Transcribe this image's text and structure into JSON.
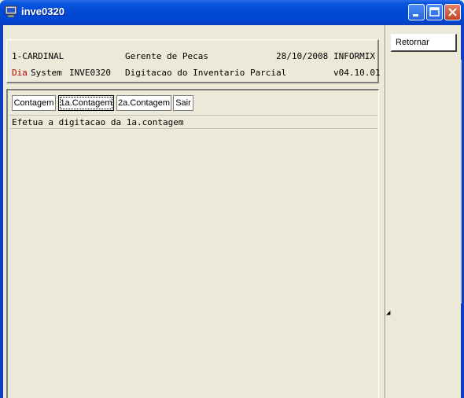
{
  "window": {
    "title": "inve0320"
  },
  "header": {
    "company": "1-CARDINAL",
    "module_title": "Gerente de Pecas",
    "date": "28/10/2008",
    "database": "INFORMIX",
    "brand_dia": "Dia",
    "brand_system": "System",
    "program": "INVE0320",
    "program_title": "Digitacao do Inventario Parcial",
    "version": "v04.10.01"
  },
  "menu": {
    "items": [
      {
        "label": "Contagem"
      },
      {
        "label": "1a.Contagem"
      },
      {
        "label": "2a.Contagem"
      },
      {
        "label": "Sair"
      }
    ],
    "selected": "1a.Contagem",
    "description": "Efetua a digitacao da 1a.contagem"
  },
  "side": {
    "retornar_label": "Retornar"
  },
  "colors": {
    "title_bar": "#0047d2",
    "accent_red": "#c00000",
    "background": "#ece9d8"
  }
}
